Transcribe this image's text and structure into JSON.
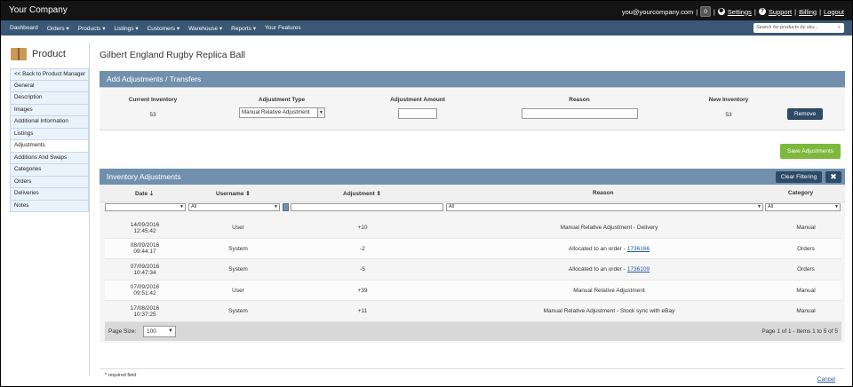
{
  "app": {
    "brand": "Your Company"
  },
  "userbar": {
    "email": "you@yourcompany.com",
    "count": "0",
    "settings": "Settings",
    "support": "Support",
    "billing": "Billing",
    "logout": "Logout"
  },
  "nav": {
    "items": [
      "Dashboard",
      "Orders ▾",
      "Products ▾",
      "Listings ▾",
      "Customers ▾",
      "Warehouse ▾",
      "Reports ▾",
      "Your Features"
    ],
    "search_placeholder": "Search for products by sku..."
  },
  "sidebar": {
    "title": "Product",
    "items": [
      "<< Back to Product Manager",
      "General",
      "Description",
      "Images",
      "Additional Information",
      "Listings",
      "Adjustments",
      "Additions And Swaps",
      "Categories",
      "Orders",
      "Deliveries",
      "Notes"
    ]
  },
  "page": {
    "title": "Gilbert England Rugby Replica Ball"
  },
  "adjust": {
    "panel_title": "Add Adjustments / Transfers",
    "col_current": "Current Inventory",
    "col_type": "Adjustment Type",
    "col_amount": "Adjustment Amount",
    "col_reason": "Reason",
    "col_new": "New Inventory",
    "current_value": "53",
    "type_value": "Manual Relative Adjustment",
    "new_value": "53",
    "remove_label": "Remove",
    "save_label": "Save Adjustments"
  },
  "inventory": {
    "panel_title": "Inventory Adjustments",
    "clear_label": "Clear Filtering",
    "headers": {
      "date": "Date ⇣",
      "username": "Username ⇕",
      "adjustment": "Adjustment ⇕",
      "reason": "Reason",
      "category": "Category"
    },
    "filters": {
      "username": "All",
      "reason": "All",
      "category": "All"
    },
    "rows": [
      {
        "date": "14/09/2016",
        "time": "12:45:42",
        "user": "User",
        "adj": "+10",
        "reason": "Manual Relative Adjustment - Delivery",
        "link": "",
        "category": "Manual"
      },
      {
        "date": "08/09/2016",
        "time": "09:44:17",
        "user": "System",
        "adj": "-2",
        "reason": "Allocated to an order -",
        "link": "1736166",
        "category": "Orders"
      },
      {
        "date": "07/09/2016",
        "time": "10:47:34",
        "user": "System",
        "adj": "-5",
        "reason": "Allocated to an order -",
        "link": "1736109",
        "category": "Orders"
      },
      {
        "date": "07/09/2016",
        "time": "09:51:42",
        "user": "User",
        "adj": "+39",
        "reason": "Manual Relative Adjustment",
        "link": "",
        "category": "Manual"
      },
      {
        "date": "17/08/2016",
        "time": "10:37:25",
        "user": "System",
        "adj": "+11",
        "reason": "Manual Relative Adjustment - Stock sync with eBay",
        "link": "",
        "category": "Manual"
      }
    ],
    "pager": {
      "size_label": "Page Size:",
      "size_value": "100",
      "info": "Page 1 of 1  -  Items 1 to 5 of 5"
    }
  },
  "footer": {
    "required": "* required field",
    "cancel": "Cancel"
  }
}
